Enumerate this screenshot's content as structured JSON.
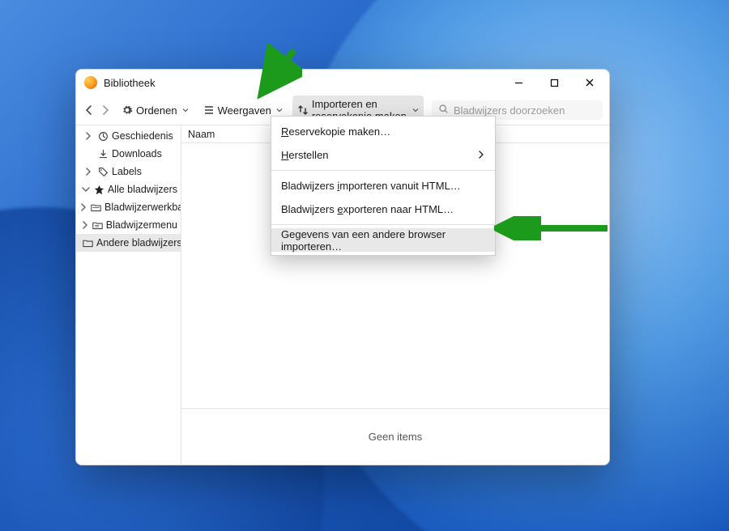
{
  "window": {
    "title": "Bibliotheek"
  },
  "toolbar": {
    "organize": "Ordenen",
    "views": "Weergaven",
    "import_backup": "Importeren en reservekopie maken",
    "search_placeholder": "Bladwijzers doorzoeken"
  },
  "sidebar": {
    "items": [
      {
        "label": "Geschiedenis",
        "icon": "clock",
        "expandable": true,
        "expanded": false,
        "depth": 0
      },
      {
        "label": "Downloads",
        "icon": "download",
        "expandable": false,
        "depth": 0
      },
      {
        "label": "Labels",
        "icon": "tag",
        "expandable": true,
        "expanded": false,
        "depth": 0
      },
      {
        "label": "Alle bladwijzers",
        "icon": "star",
        "expandable": true,
        "expanded": true,
        "depth": 0
      },
      {
        "label": "Bladwijzerwerkbalk",
        "icon": "folder-toolbar",
        "expandable": true,
        "expanded": false,
        "depth": 1
      },
      {
        "label": "Bladwijzermenu",
        "icon": "folder-menu",
        "expandable": true,
        "expanded": false,
        "depth": 1
      },
      {
        "label": "Andere bladwijzers",
        "icon": "folder",
        "expandable": false,
        "depth": 1,
        "selected": true
      }
    ]
  },
  "content": {
    "column_header": "Naam",
    "empty_text": "Geen items"
  },
  "menu": {
    "items": [
      {
        "label": "Reservekopie maken…",
        "u": 0
      },
      {
        "label": "Herstellen",
        "submenu": true,
        "u": 0
      },
      {
        "sep": true
      },
      {
        "label": "Bladwijzers importeren vanuit HTML…",
        "u": 12
      },
      {
        "label": "Bladwijzers exporteren naar HTML…",
        "u": 12
      },
      {
        "sep": true
      },
      {
        "label": "Gegevens van een andere browser importeren…",
        "hover": true
      }
    ]
  }
}
